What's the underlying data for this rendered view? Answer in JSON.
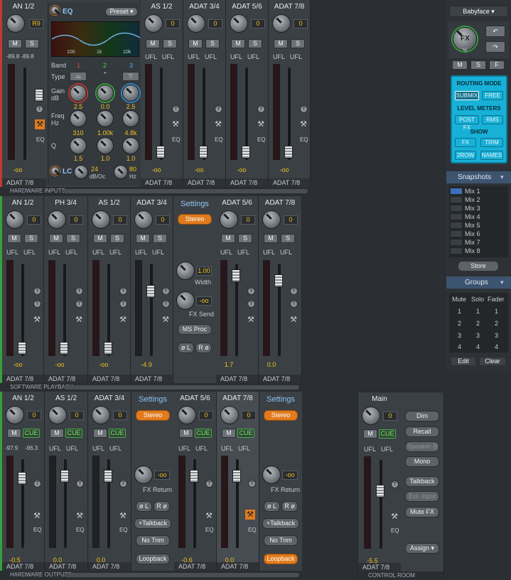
{
  "colors": {
    "accent": "#e07b1d",
    "level": "#f0c020",
    "cue": "#7fe07f",
    "routing_bg": "#17b1d8"
  },
  "hw_inputs": {
    "section_label": "HARDWARE INPUTS",
    "first": {
      "name": "AN 1/2",
      "gain": "R9",
      "mute": "M",
      "solo": "S",
      "level_readout": "-89.8 -89.8",
      "fader_value": "-oo",
      "footer": "ADAT 7/8",
      "eq_label": "EQ",
      "eq_preset": "Preset",
      "freq_ticks": [
        "100",
        "1k",
        "10k"
      ],
      "band_label": "Band",
      "bands": [
        "1",
        "2",
        "3"
      ],
      "type_label": "Type",
      "gain_label": "Gain dB",
      "gain_values": [
        "2.5",
        "0.0",
        "2.5"
      ],
      "freq_label": "Freq Hz",
      "freq_values": [
        "310",
        "1.00k",
        "4.8k"
      ],
      "q_label": "Q",
      "q_values": [
        "1.5",
        "1.0",
        "1.0"
      ],
      "lc_label": "LC",
      "lc_slope": "24",
      "lc_unit": "dB/Oc",
      "lc_freq": "80",
      "lc_hz": "Hz",
      "eq_button": "EQ"
    },
    "channels": [
      {
        "name": "AS 1/2",
        "gain": "0",
        "ufl": "UFL",
        "ufr": "UFL",
        "value": "-oo",
        "footer": "ADAT 7/8"
      },
      {
        "name": "ADAT 3/4",
        "gain": "0",
        "ufl": "UFL",
        "ufr": "UFL",
        "value": "-oo",
        "footer": "ADAT 7/8"
      },
      {
        "name": "ADAT 5/6",
        "gain": "0",
        "ufl": "UFL",
        "ufr": "UFL",
        "value": "-oo",
        "footer": "ADAT 7/8"
      },
      {
        "name": "ADAT 7/8",
        "gain": "0",
        "ufl": "UFL",
        "ufr": "UFL",
        "value": "-oo",
        "footer": "ADAT 7/8"
      }
    ]
  },
  "sw_playback": {
    "section_label": "SOFTWARE PLAYBACK",
    "channels": [
      {
        "name": "AN 1/2",
        "gain": "0",
        "value": "-oo",
        "footer": "ADAT 7/8"
      },
      {
        "name": "PH 3/4",
        "gain": "0",
        "value": "-oo",
        "footer": "ADAT 7/8"
      },
      {
        "name": "AS 1/2",
        "gain": "0",
        "value": "-oo",
        "footer": "ADAT 7/8"
      },
      {
        "name": "ADAT 3/4",
        "gain": "0",
        "value": "-4.9",
        "footer": "ADAT 7/8"
      }
    ],
    "channels2": [
      {
        "name": "ADAT 5/6",
        "gain": "0",
        "value": "1.7",
        "footer": "ADAT 7/8"
      },
      {
        "name": "ADAT 7/8",
        "gain": "0",
        "value": "0.0",
        "footer": "ADAT 7/8"
      }
    ],
    "settings": {
      "title": "Settings",
      "stereo": "Stereo",
      "width_value": "1.00",
      "width_label": "Width",
      "fxsend_value": "-oo",
      "fxsend_label": "FX Send",
      "msproc": "MS Proc",
      "phase_l": "ø L",
      "phase_r": "R ø"
    }
  },
  "hw_outputs": {
    "section_label": "HARDWARE OUTPUTS",
    "channels": [
      {
        "name": "AN 1/2",
        "gain": "0",
        "mute": "M",
        "cue": "CUE",
        "l": "-97.9",
        "r": "-96.3",
        "value": "-0.5",
        "footer": "ADAT 7/8"
      },
      {
        "name": "AS 1/2",
        "gain": "0",
        "mute": "M",
        "cue": "CUE",
        "l": "UFL",
        "r": "UFL",
        "value": "0.0",
        "footer": "ADAT 7/8"
      },
      {
        "name": "ADAT 3/4",
        "gain": "0",
        "mute": "M",
        "cue": "CUE",
        "l": "UFL",
        "r": "UFL",
        "value": "0.0",
        "footer": "ADAT 7/8"
      }
    ],
    "channels2": [
      {
        "name": "ADAT 5/6",
        "gain": "0",
        "mute": "M",
        "cue": "CUE",
        "l": "UFL",
        "r": "UFL",
        "value": "-0.6",
        "footer": "ADAT 7/8"
      },
      {
        "name": "ADAT 7/8",
        "gain": "0",
        "mute": "M",
        "cue": "CUE",
        "l": "UFL",
        "r": "UFL",
        "value": "0.0",
        "footer": "ADAT 7/8"
      }
    ],
    "settings": {
      "title": "Settings",
      "stereo": "Stereo",
      "fxreturn_value": "-oo",
      "fxreturn_label": "FX Return",
      "phase_l": "ø L",
      "phase_r": "R ø",
      "talkback": "+Talkback",
      "notrim": "No Trim",
      "loopback": "Loopback"
    }
  },
  "control_room": {
    "section_label": "CONTROL ROOM",
    "name": "Main",
    "gain": "0",
    "mute": "M",
    "cue": "CUE",
    "l": "UFL",
    "r": "UFL",
    "value": "-5.5",
    "footer": "ADAT 7/8",
    "buttons": [
      "Dim",
      "Recall",
      "Speaker B",
      "Mono",
      "Talkback",
      "Ext. Input",
      "Mute FX",
      "Assign"
    ]
  },
  "sidebar": {
    "device": "Babyface",
    "fx_label": "FX",
    "fx_pct": "%",
    "mute": "M",
    "solo": "S",
    "fader": "F",
    "routing_title": "ROUTING MODE",
    "submix": "SUBMIX",
    "free": "FREE",
    "meters_title": "LEVEL METERS",
    "postfx": "POST FX",
    "rms": "RMS",
    "show_title": "SHOW",
    "fx": "FX",
    "trim": "TRIM",
    "row2": "2ROW",
    "names": "NAMES",
    "snapshots_title": "Snapshots",
    "snapshots": [
      "Mix 1",
      "Mix 2",
      "Mix 3",
      "Mix 4",
      "Mix 5",
      "Mix 6",
      "Mix 7",
      "Mix 8"
    ],
    "store": "Store",
    "groups_title": "Groups",
    "groups_headers": [
      "Mute",
      "Solo",
      "Fader"
    ],
    "groups_rows": [
      [
        "1",
        "1",
        "1"
      ],
      [
        "2",
        "2",
        "2"
      ],
      [
        "3",
        "3",
        "3"
      ],
      [
        "4",
        "4",
        "4"
      ]
    ],
    "edit": "Edit",
    "clear": "Clear"
  }
}
